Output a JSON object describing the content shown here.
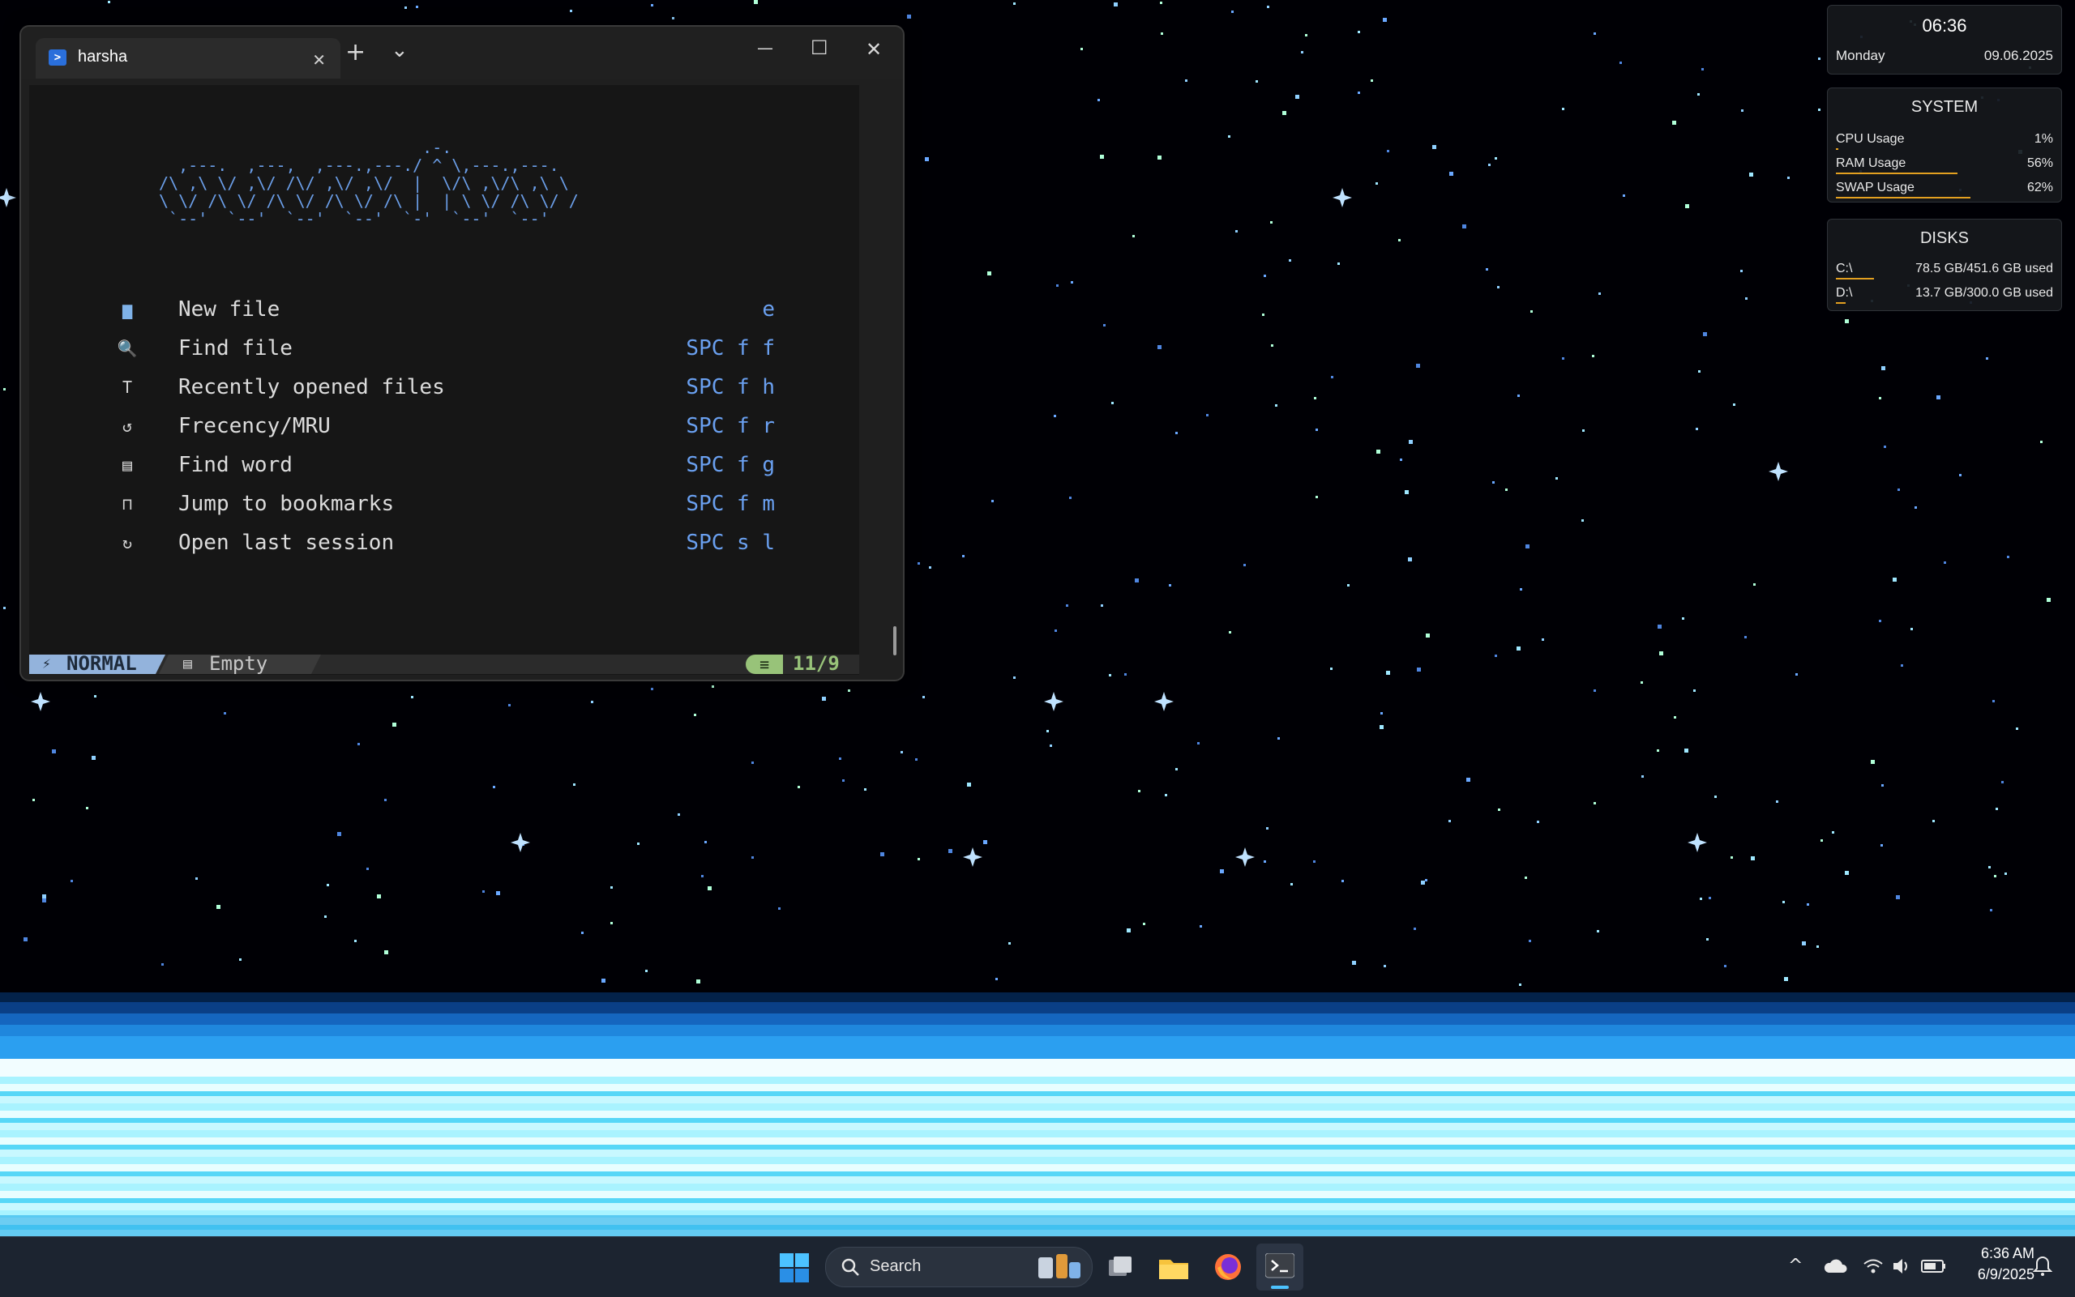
{
  "terminal": {
    "tab_title": "harsha",
    "tab_close": "✕",
    "new_tab": "+",
    "tab_dropdown": "⌄",
    "minimize": "—",
    "maximize": "☐",
    "close": "✕",
    "menu": [
      {
        "label": "New file",
        "key": "e",
        "icon": "new-file-icon",
        "glyph": "▆"
      },
      {
        "label": "Find file",
        "key": "SPC f f",
        "icon": "find-file-icon",
        "glyph": "🔍"
      },
      {
        "label": "Recently opened files",
        "key": "SPC f h",
        "icon": "recent-files-icon",
        "glyph": "T"
      },
      {
        "label": "Frecency/MRU",
        "key": "SPC f r",
        "icon": "history-icon",
        "glyph": "↺"
      },
      {
        "label": "Find word",
        "key": "SPC f g",
        "icon": "find-word-icon",
        "glyph": "▤"
      },
      {
        "label": "Jump to bookmarks",
        "key": "SPC f m",
        "icon": "bookmark-icon",
        "glyph": "⊓"
      },
      {
        "label": "Open last session",
        "key": "SPC s l",
        "icon": "restore-session-icon",
        "glyph": "↻"
      }
    ],
    "statusline": {
      "mode": "NORMAL",
      "mode_icon": "⚡",
      "file_icon": "▤",
      "file": "Empty",
      "pos_icon": "≡",
      "position": "11/9"
    }
  },
  "widgets": {
    "clock": {
      "time": "06:36",
      "day": "Monday",
      "date": "09.06.2025"
    },
    "system": {
      "title": "SYSTEM",
      "rows": [
        {
          "label": "CPU Usage",
          "value": "1%",
          "fraction": 0.01
        },
        {
          "label": "RAM Usage",
          "value": "56%",
          "fraction": 0.56
        },
        {
          "label": "SWAP Usage",
          "value": "62%",
          "fraction": 0.62
        }
      ]
    },
    "disks": {
      "title": "DISKS",
      "rows": [
        {
          "label": "C:\\",
          "value": "78.5 GB/451.6 GB used",
          "fraction": 0.174
        },
        {
          "label": "D:\\",
          "value": "13.7 GB/300.0 GB used",
          "fraction": 0.046
        }
      ]
    }
  },
  "taskbar": {
    "search_placeholder": "Search",
    "tray_chevron": "^",
    "time": "6:36 AM",
    "date": "6/9/2025"
  },
  "colors": {
    "accent_blue": "#6aa0f0",
    "mode_bg": "#93b3dc",
    "position_green": "#98c379",
    "meter_orange": "#e3a020"
  }
}
